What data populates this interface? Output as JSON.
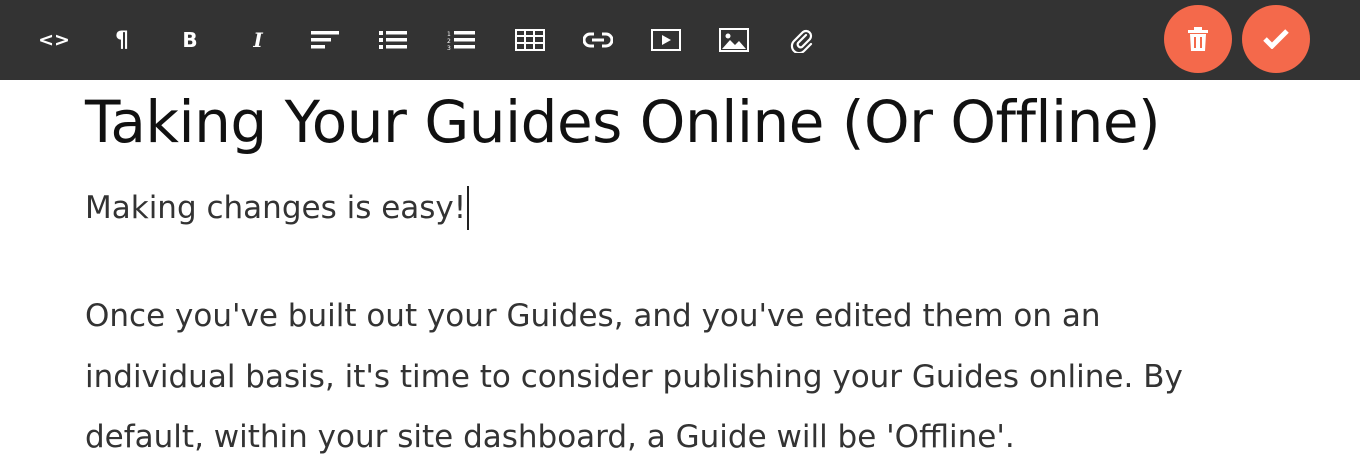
{
  "toolbar": {
    "tools": [
      {
        "name": "code",
        "label": "<>"
      },
      {
        "name": "paragraph",
        "label": "¶"
      },
      {
        "name": "bold",
        "label": "B"
      },
      {
        "name": "italic",
        "label": "I"
      },
      {
        "name": "align",
        "icon": "align-left-icon"
      },
      {
        "name": "bullet-list",
        "icon": "bullet-list-icon"
      },
      {
        "name": "numbered-list",
        "icon": "numbered-list-icon"
      },
      {
        "name": "table",
        "icon": "table-icon"
      },
      {
        "name": "link",
        "icon": "link-icon"
      },
      {
        "name": "video",
        "icon": "video-icon"
      },
      {
        "name": "image",
        "icon": "image-icon"
      },
      {
        "name": "attachment",
        "icon": "paperclip-icon"
      }
    ],
    "delete_icon": "trash-icon",
    "confirm_icon": "checkmark-icon",
    "accent_color": "#f4694b",
    "bar_color": "#333333"
  },
  "document": {
    "title": "Taking Your Guides Online (Or Offline)",
    "subtitle": "Making changes is easy!",
    "body": "Once you've built out your Guides, and you've edited them on an individual basis, it's time to consider publishing your Guides online. By default, within your site dashboard, a Guide will be 'Offline'."
  }
}
